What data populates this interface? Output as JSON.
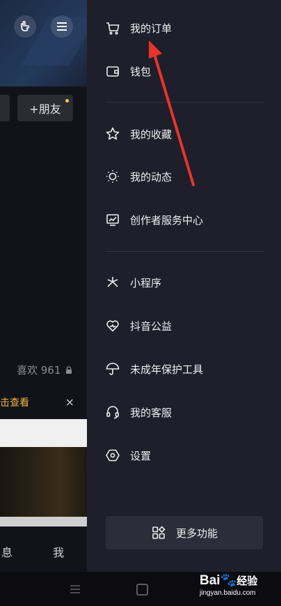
{
  "left": {
    "friend_label": "+朋友",
    "likes_text": "喜欢 961",
    "notice_text": "点击查看",
    "notice_close": "×",
    "tab_messages": "息",
    "tab_me": "我"
  },
  "drawer": {
    "items": [
      {
        "label": "我的订单",
        "icon": "cart-icon"
      },
      {
        "label": "钱包",
        "icon": "wallet-icon"
      },
      {
        "label": "我的收藏",
        "icon": "star-icon"
      },
      {
        "label": "我的动态",
        "icon": "sun-icon"
      },
      {
        "label": "创作者服务中心",
        "icon": "chart-monitor-icon"
      },
      {
        "label": "小程序",
        "icon": "mini-program-icon"
      },
      {
        "label": "抖音公益",
        "icon": "heart-charity-icon"
      },
      {
        "label": "未成年保护工具",
        "icon": "umbrella-icon"
      },
      {
        "label": "我的客服",
        "icon": "headset-icon"
      },
      {
        "label": "设置",
        "icon": "settings-hexagon-icon"
      }
    ],
    "more_label": "更多功能"
  },
  "watermark": {
    "brand": "Bai",
    "brand_suffix": "经验",
    "url": "jingyan.baidu.com"
  },
  "colors": {
    "drawer_bg": "#1e1f2a",
    "arrow": "#e8342c",
    "notice": "#f2b441"
  }
}
